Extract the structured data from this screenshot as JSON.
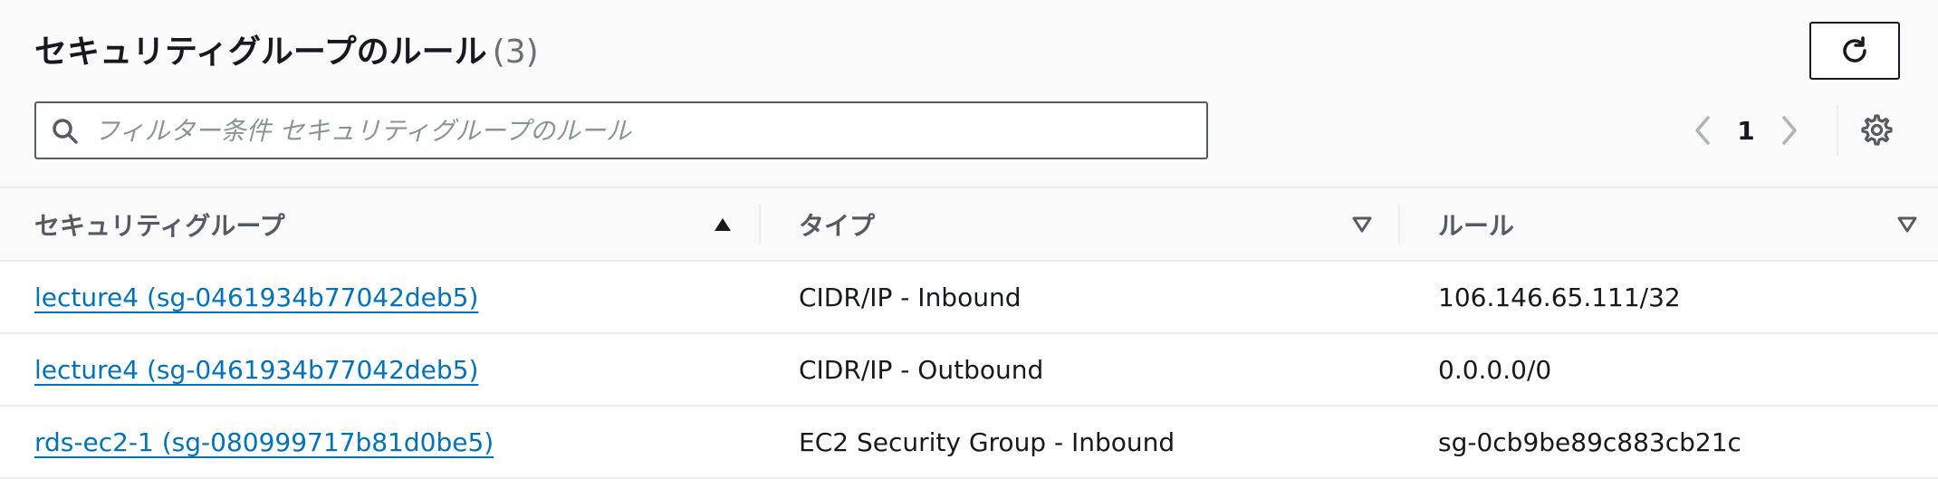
{
  "header": {
    "title": "セキュリティグループのルール",
    "count": "(3)"
  },
  "search": {
    "placeholder": "フィルター条件 セキュリティグループのルール"
  },
  "pagination": {
    "current_page": "1"
  },
  "table": {
    "columns": [
      {
        "label": "セキュリティグループ",
        "sort": "ascending"
      },
      {
        "label": "タイプ",
        "sort": "none"
      },
      {
        "label": "ルール",
        "sort": "none"
      }
    ],
    "rows": [
      {
        "security_group": "lecture4 (sg-0461934b77042deb5)",
        "type": "CIDR/IP - Inbound",
        "rule": "106.146.65.111/32"
      },
      {
        "security_group": "lecture4 (sg-0461934b77042deb5)",
        "type": "CIDR/IP - Outbound",
        "rule": "0.0.0.0/0"
      },
      {
        "security_group": "rds-ec2-1 (sg-080999717b81d0be5)",
        "type": "EC2 Security Group - Inbound",
        "rule": "sg-0cb9be89c883cb21c"
      }
    ]
  },
  "colors": {
    "link": "#0073bb",
    "text": "#16191f",
    "muted": "#687078",
    "border": "#eaeded"
  },
  "icons": [
    "refresh-icon",
    "search-icon",
    "chevron-left-icon",
    "chevron-right-icon",
    "settings-gear-icon",
    "sort-ascending-icon",
    "sort-descending-icon"
  ]
}
